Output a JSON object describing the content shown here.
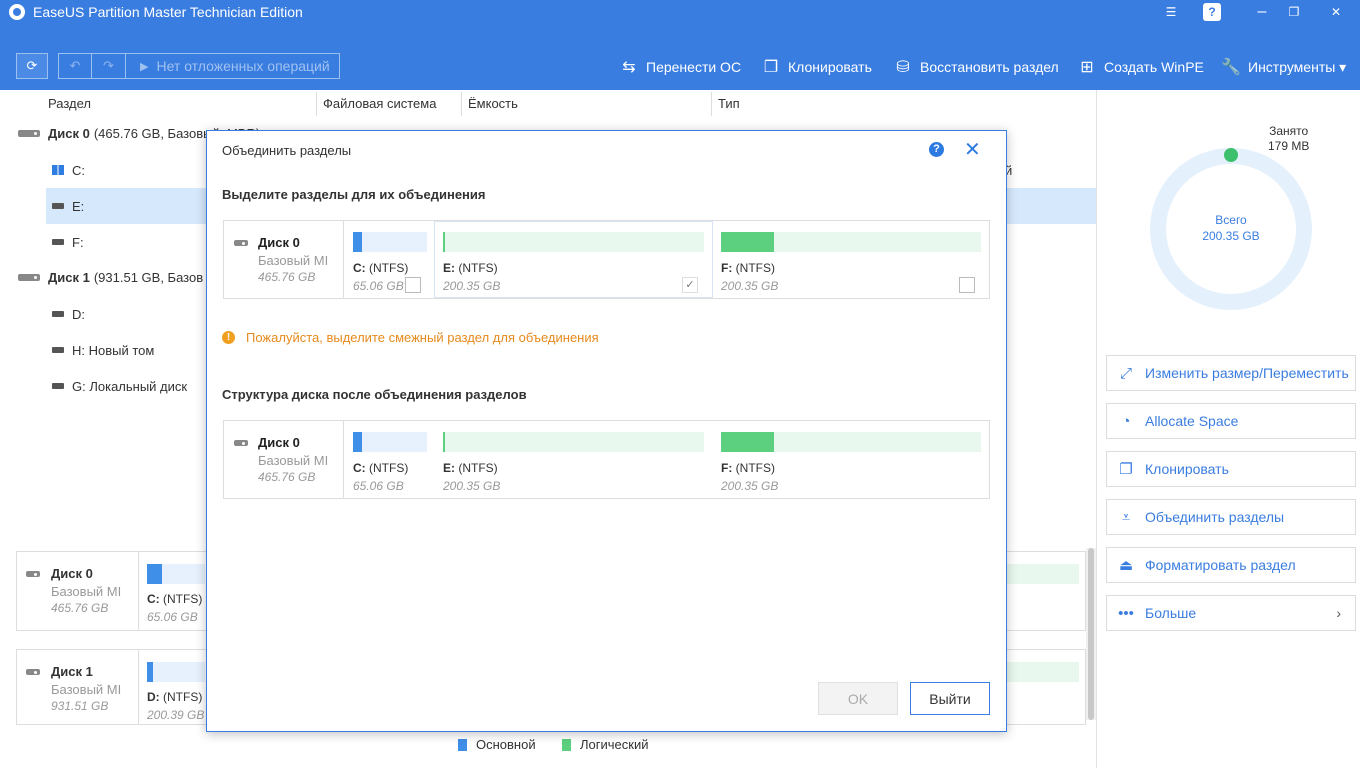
{
  "window": {
    "title": "EaseUS Partition Master Technician Edition",
    "controls": [
      "☰",
      "?",
      "❐",
      "✕"
    ]
  },
  "toolbar": {
    "pending_label": "Нет отложенных операций",
    "actions": [
      {
        "label": "Перенести ОС",
        "icon": "migrate-os-icon"
      },
      {
        "label": "Клонировать",
        "icon": "clone-icon"
      },
      {
        "label": "Восстановить раздел",
        "icon": "recover-partition-icon"
      },
      {
        "label": "Создать WinPE",
        "icon": "windows-icon"
      },
      {
        "label": "Инструменты ▾",
        "icon": "wrench-icon"
      }
    ]
  },
  "table": {
    "headers": [
      "Раздел",
      "Файловая система",
      "Ёмкость",
      "Тип"
    ],
    "rows": [
      {
        "label": "Диск 0",
        "detail": "(465.76 GB, Базовый, MBR)",
        "kind": "disk"
      },
      {
        "label": "C:",
        "kind": "partition",
        "tail": "й"
      },
      {
        "label": "E:",
        "kind": "partition",
        "selected": true
      },
      {
        "label": "F:",
        "kind": "partition"
      },
      {
        "label": "Диск 1",
        "detail": "(931.51 GB, Базов",
        "kind": "disk"
      },
      {
        "label": "D:",
        "kind": "partition"
      },
      {
        "label": "H: Новый том",
        "kind": "partition"
      },
      {
        "label": "G: Локальный диск",
        "kind": "partition"
      }
    ]
  },
  "bottom_disks": [
    {
      "name": "Диск 0",
      "type": "Базовый MI",
      "size": "465.76 GB",
      "part_label": "C:",
      "part_fs": "(NTFS)",
      "part_size": "65.06 GB"
    },
    {
      "name": "Диск 1",
      "type": "Базовый MI",
      "size": "931.51 GB",
      "part_label": "D:",
      "part_fs": "(NTFS)",
      "part_size": "200.39 GB"
    }
  ],
  "legend": [
    {
      "label": "Основной",
      "color": "#3f8ee8"
    },
    {
      "label": "Логический",
      "color": "#5cd07f"
    }
  ],
  "right_panel": {
    "used_label": "Занято",
    "used_value": "179 MB",
    "total_label": "Всего",
    "total_value": "200.35 GB",
    "actions": [
      {
        "label": "Изменить размер/Переместить",
        "icon": "resize-icon"
      },
      {
        "label": "Allocate Space",
        "icon": "pie-icon"
      },
      {
        "label": "Клонировать",
        "icon": "clone-icon"
      },
      {
        "label": "Объединить разделы",
        "icon": "merge-icon"
      },
      {
        "label": "Форматировать раздел",
        "icon": "format-icon"
      },
      {
        "label": "Больше",
        "icon": "more-icon"
      }
    ]
  },
  "dialog": {
    "title": "Объединить разделы",
    "select_heading": "Выделите разделы для их объединения",
    "warning": "Пожалуйста, выделите смежный раздел для объединения",
    "result_heading": "Структура диска после объединения разделов",
    "disk": {
      "name": "Диск 0",
      "type": "Базовый MI",
      "size": "465.76 GB"
    },
    "partitions": [
      {
        "label": "C:",
        "fs": "(NTFS)",
        "size": "65.06 GB",
        "checked": false
      },
      {
        "label": "E:",
        "fs": "(NTFS)",
        "size": "200.35 GB",
        "checked": true
      },
      {
        "label": "F:",
        "fs": "(NTFS)",
        "size": "200.35 GB",
        "checked": false
      }
    ],
    "ok_label": "OK",
    "exit_label": "Выйти"
  }
}
